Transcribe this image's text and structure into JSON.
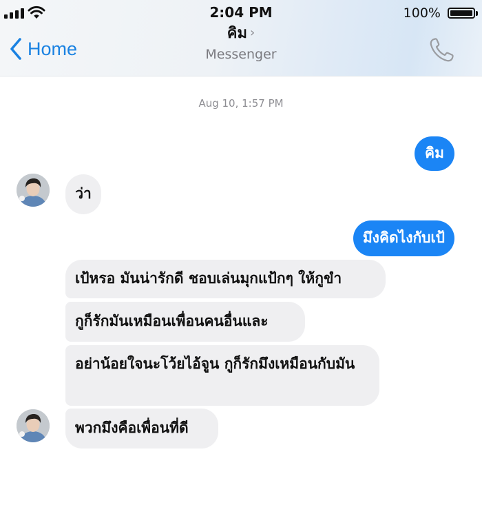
{
  "status_bar": {
    "time": "2:04 PM",
    "battery": "100%"
  },
  "nav": {
    "back_label": "Home",
    "title": "คิม",
    "title_chevron": "›",
    "subtitle": "Messenger"
  },
  "conversation": {
    "timestamp": "Aug 10, 1:57 PM",
    "messages": [
      {
        "from": "me",
        "text": "คิม"
      },
      {
        "from": "them",
        "text": "ว่า"
      },
      {
        "from": "me",
        "text": "มึงคิดไงกับเป้"
      },
      {
        "from": "them",
        "text": "เป้หรอ มันน่ารักดี ชอบเล่นมุกแป้กๆ ให้กูขำ"
      },
      {
        "from": "them",
        "text": "กูก็รักมันเหมือนเพื่อนคนอื่นและ"
      },
      {
        "from": "them",
        "text": "อย่าน้อยใจนะโว้ยไอ้จูน กูก็รักมึงเหมือนกับมัน"
      },
      {
        "from": "them",
        "text": "พวกมึงคือเพื่อนที่ดี"
      }
    ]
  },
  "colors": {
    "accent": "#1b85f5",
    "incoming_bubble": "#efeff1",
    "back_link": "#1a82e2"
  },
  "icons": [
    "signal-bars-icon",
    "wifi-icon",
    "battery-icon",
    "chevron-left-icon",
    "phone-icon"
  ]
}
